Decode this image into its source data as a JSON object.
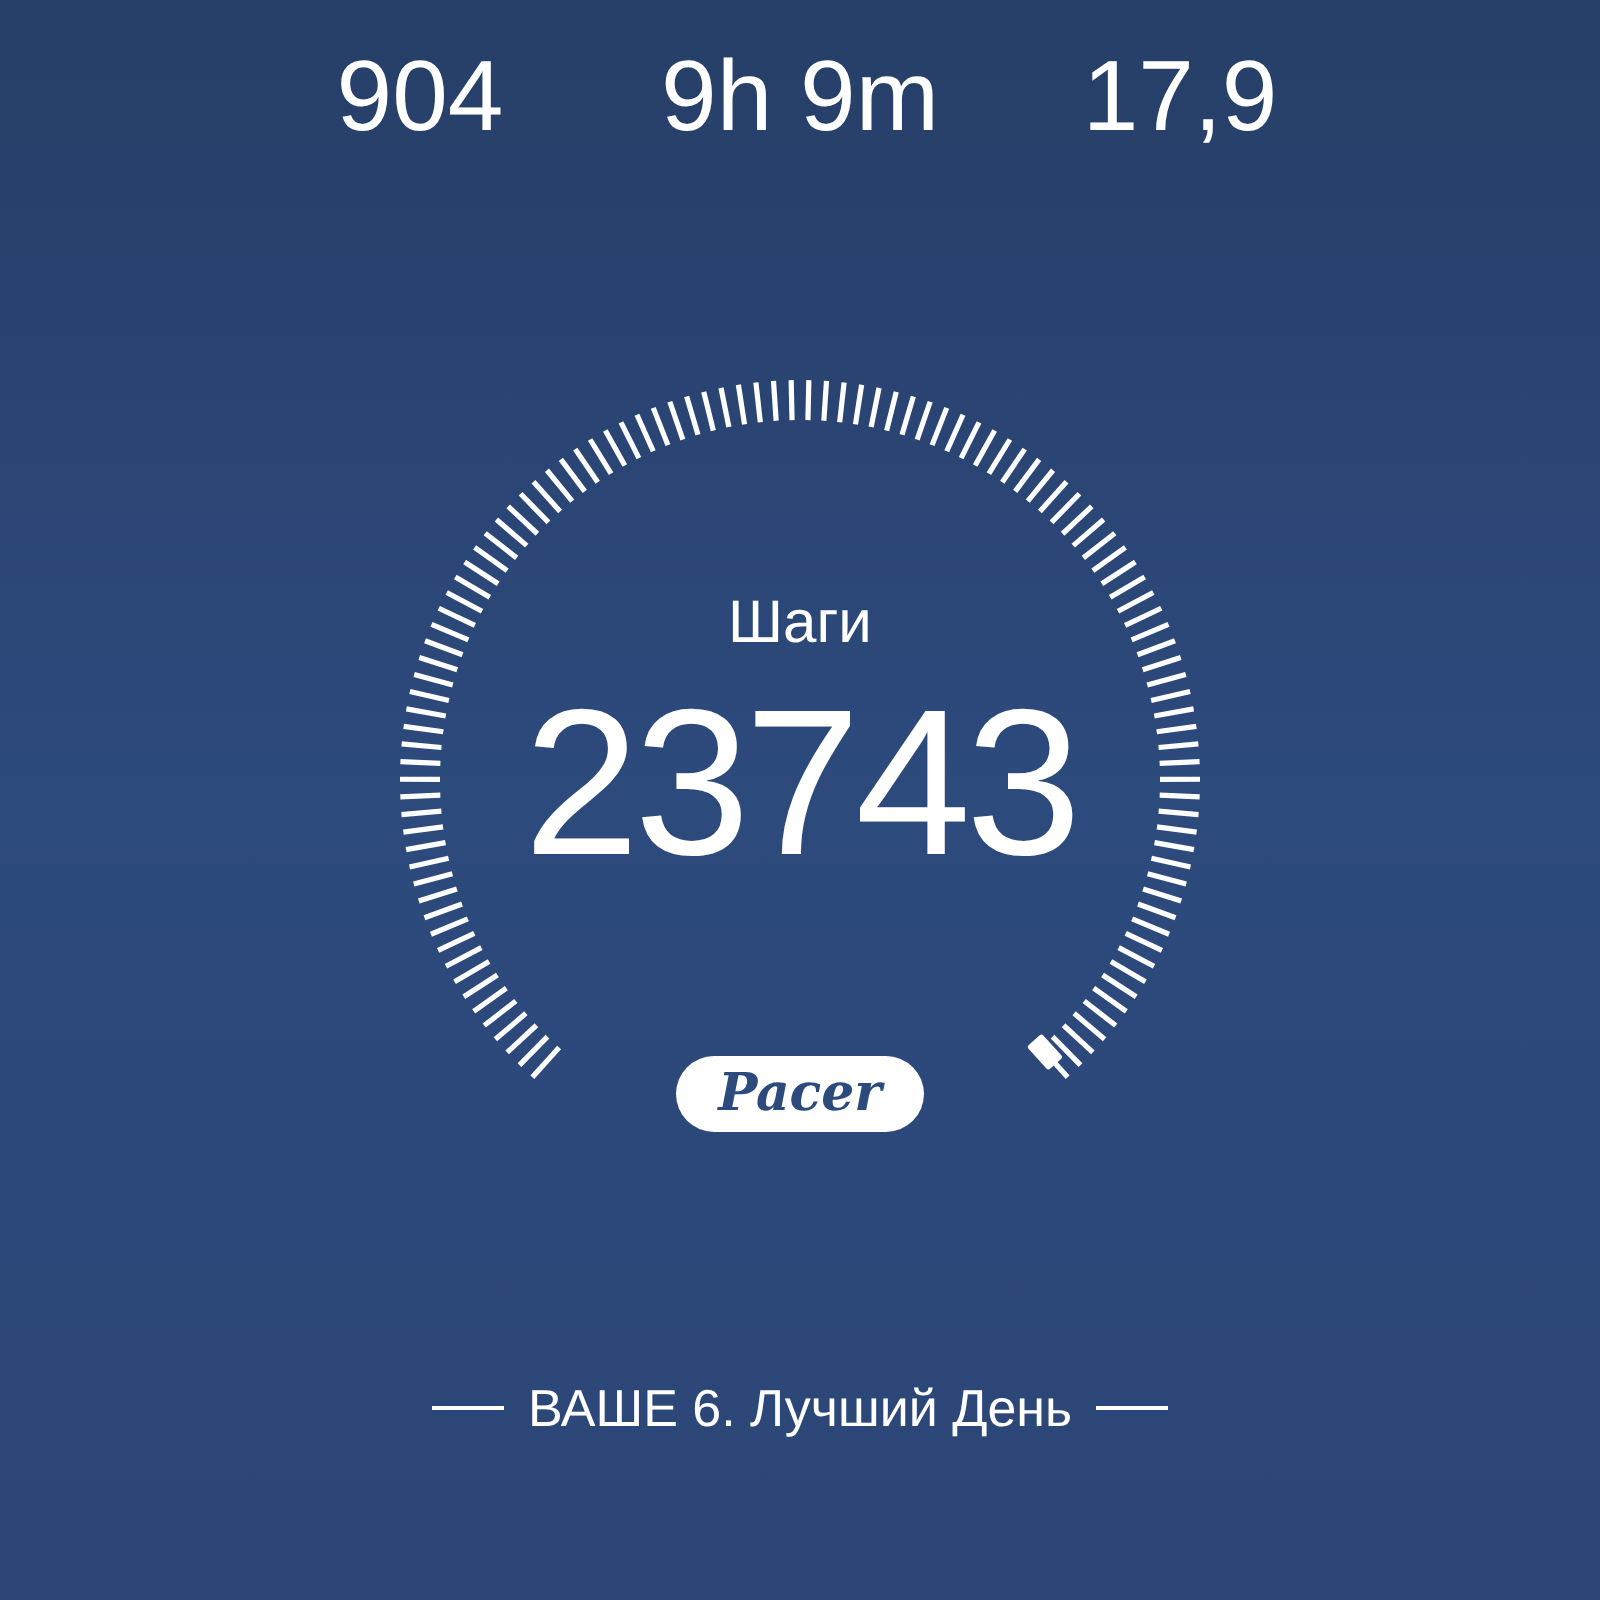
{
  "stats": [
    {
      "value": "904"
    },
    {
      "value": "9h 9m"
    },
    {
      "value": "17,9"
    }
  ],
  "gauge": {
    "label": "Шаги",
    "value": "23743"
  },
  "logo": {
    "text": "Pacer"
  },
  "footer": {
    "text": "ВАШЕ 6. Лучший День"
  }
}
